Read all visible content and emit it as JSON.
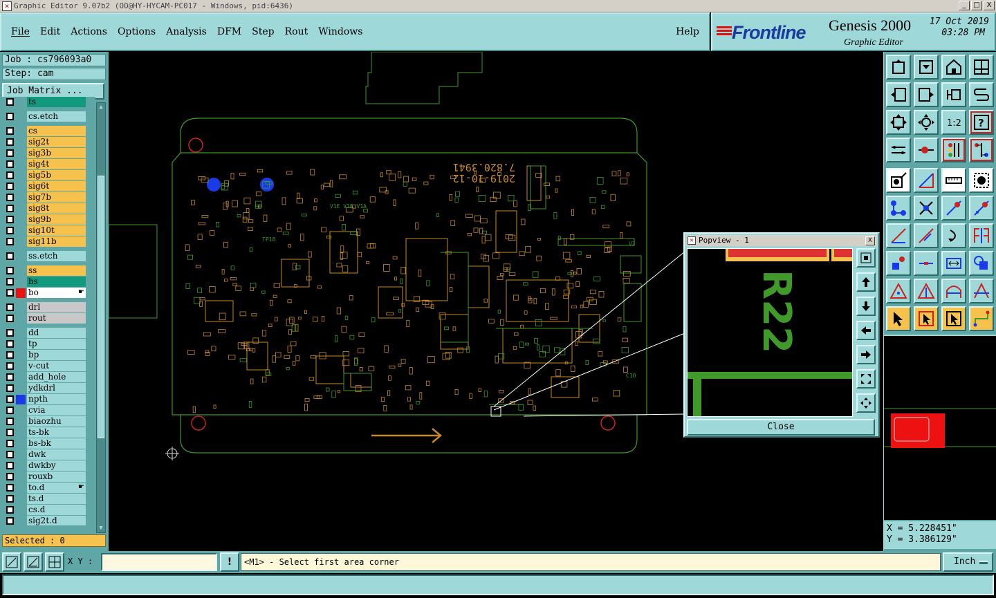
{
  "window": {
    "title": "Graphic Editor 9.07b2 (OO@HY-HYCAM-PC017 - Windows, pid:6436)",
    "min": "_",
    "max": "□",
    "close": "X"
  },
  "menu": {
    "items": [
      "File",
      "Edit",
      "Actions",
      "Options",
      "Analysis",
      "DFM",
      "Step",
      "Rout",
      "Windows"
    ],
    "help": "Help"
  },
  "brand": {
    "logo": "Frontline",
    "product": "Genesis 2000",
    "subtitle": "Graphic Editor",
    "date": "17 Oct 2019",
    "time": "03:28 PM"
  },
  "job": {
    "job_label": "Job : cs796093a0",
    "step_label": "Step: cam",
    "matrix_button": "Job Matrix ..."
  },
  "layers": [
    {
      "name": "ts",
      "type": "sel",
      "color": ""
    },
    {
      "name": "cs.etch",
      "type": "misc",
      "color": ""
    },
    {
      "name": "cs",
      "type": "board",
      "color": ""
    },
    {
      "name": "sig2t",
      "type": "board",
      "color": ""
    },
    {
      "name": "sig3b",
      "type": "board",
      "color": ""
    },
    {
      "name": "sig4t",
      "type": "board",
      "color": ""
    },
    {
      "name": "sig5b",
      "type": "board",
      "color": ""
    },
    {
      "name": "sig6t",
      "type": "board",
      "color": ""
    },
    {
      "name": "sig7b",
      "type": "board",
      "color": ""
    },
    {
      "name": "sig8t",
      "type": "board",
      "color": ""
    },
    {
      "name": "sig9b",
      "type": "board",
      "color": ""
    },
    {
      "name": "sig10t",
      "type": "board",
      "color": ""
    },
    {
      "name": "sig11b",
      "type": "board",
      "color": ""
    },
    {
      "name": "ss.etch",
      "type": "misc",
      "color": ""
    },
    {
      "name": "ss",
      "type": "board",
      "color": ""
    },
    {
      "name": "bs",
      "type": "sel",
      "color": ""
    },
    {
      "name": "bo",
      "type": "wht",
      "color": "#ee1111",
      "hand": true
    },
    {
      "name": "drl",
      "type": "drl",
      "color": ""
    },
    {
      "name": "rout",
      "type": "drl",
      "color": ""
    },
    {
      "name": "dd",
      "type": "misc",
      "color": ""
    },
    {
      "name": "tp",
      "type": "misc",
      "color": ""
    },
    {
      "name": "bp",
      "type": "misc",
      "color": ""
    },
    {
      "name": "v-cut",
      "type": "misc",
      "color": ""
    },
    {
      "name": "add_hole",
      "type": "misc",
      "color": ""
    },
    {
      "name": "ydkdrl",
      "type": "misc",
      "color": ""
    },
    {
      "name": "npth",
      "type": "misc",
      "color": "#1a3ae8"
    },
    {
      "name": "cvia",
      "type": "misc",
      "color": ""
    },
    {
      "name": "biaozhu",
      "type": "misc",
      "color": ""
    },
    {
      "name": "ts-bk",
      "type": "misc",
      "color": ""
    },
    {
      "name": "bs-bk",
      "type": "misc",
      "color": ""
    },
    {
      "name": "dwk",
      "type": "misc",
      "color": ""
    },
    {
      "name": "dwkby",
      "type": "misc",
      "color": ""
    },
    {
      "name": "rouxb",
      "type": "misc",
      "color": ""
    },
    {
      "name": "to.d",
      "type": "misc",
      "color": "",
      "hand": true
    },
    {
      "name": "ts.d",
      "type": "misc",
      "color": ""
    },
    {
      "name": "cs.d",
      "type": "misc",
      "color": ""
    },
    {
      "name": "sig2t.d",
      "type": "misc",
      "color": ""
    }
  ],
  "selected": "Selected : 0",
  "board": {
    "date_code_1": "7.820.3941",
    "date_code_2": "2019-10-12",
    "label_tp18": "TP18",
    "label_vl": "V1E V1B V1A",
    "label_c10": "C10",
    "label_v2": "V2"
  },
  "popview": {
    "title": "Popview - 1",
    "zoom_text": "R22",
    "close_button": "Close",
    "close_x": "X"
  },
  "coords": {
    "x": "X = 5.228451\"",
    "y": "Y = 3.386129\""
  },
  "bottom": {
    "xy_label": "X Y :",
    "xy_value": "",
    "warn_icon": "!",
    "message": "<M1> - Select first area corner",
    "unit": "Inch"
  },
  "colors": {
    "panel": "#9fd8d8",
    "panel_dark": "#5fa6a6",
    "layer_board": "#f5c24e",
    "layer_selected": "#119a7e",
    "trace_green": "#3f9a2a",
    "trace_orange": "#c98a2a",
    "npth_blue": "#1a3ae8"
  },
  "tools": {
    "row1": [
      "open-step-icon",
      "save-icon",
      "home-icon",
      "window-split-icon"
    ],
    "row2": [
      "zoom-out-icon",
      "zoom-in-icon",
      "zoom-back-icon",
      "pan-icon"
    ],
    "row3": [
      "zoom-fit-icon",
      "zoom-center-icon",
      "scale-1to2-icon",
      "help-icon"
    ],
    "row4": [
      "measure-tool-icon",
      "ruler-snap-icon",
      "layer-toggle-icon",
      "layer-compare-icon"
    ],
    "row5": [
      "pointer-info-icon",
      "select-region-icon",
      "ruler-icon",
      "dashed-box-icon"
    ],
    "row6": [
      "connect-pads-icon",
      "cross-select-icon",
      "line-pad-icon",
      "line-pad-alt-icon"
    ],
    "row7": [
      "angle-line-icon",
      "slash-line-icon",
      "arc-icon",
      "flip-icon"
    ],
    "row8": [
      "pad-square-icon",
      "line-segment-icon",
      "dimension-icon",
      "polygon-icon"
    ],
    "row9": [
      "triangle-icon",
      "triangle-alt-icon",
      "arch-icon",
      "arch-alt-icon"
    ],
    "row10": [
      "pointer-icon",
      "pointer-frame-icon",
      "pointer-frame-alt-icon",
      "route-path-icon"
    ]
  }
}
